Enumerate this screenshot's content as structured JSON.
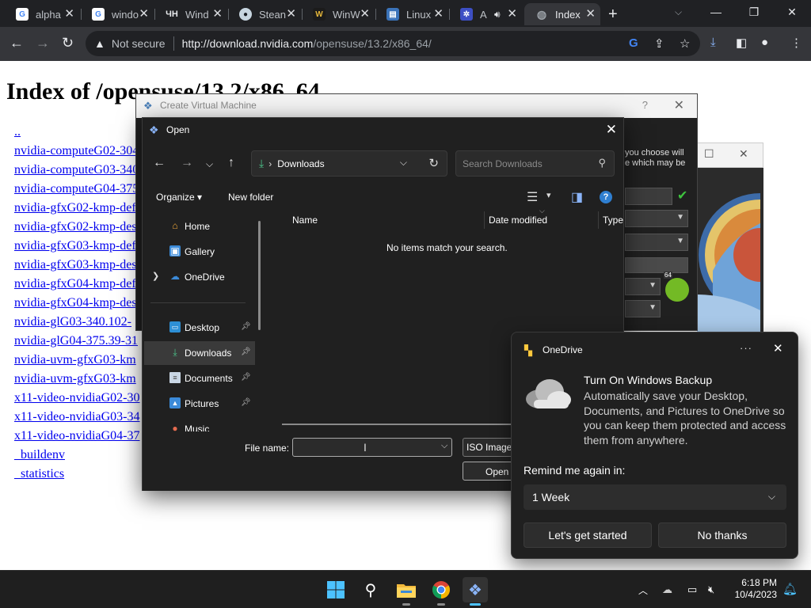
{
  "browser": {
    "tabs": [
      {
        "title": "alpha",
        "favicon": "google-g"
      },
      {
        "title": "windo",
        "favicon": "google-g"
      },
      {
        "title": "Wind",
        "favicon": "4h-logo"
      },
      {
        "title": "Stean",
        "favicon": "steam-logo"
      },
      {
        "title": "WinW",
        "favicon": "winworld-logo"
      },
      {
        "title": "Linux",
        "favicon": "linux-doc-logo"
      },
      {
        "title": "A",
        "favicon": "bluesky-logo"
      },
      {
        "title": "Index",
        "favicon": "globe"
      }
    ],
    "new_tab": "+",
    "security_label": "Not secure",
    "url_host": "http://download.nvidia.com",
    "url_path": "/opensuse/13.2/x86_64/"
  },
  "page": {
    "heading": "Index of /opensuse/13.2/x86_64",
    "entries": [
      "..",
      "nvidia-computeG02-304",
      "nvidia-computeG03-340",
      "nvidia-computeG04-375",
      "nvidia-gfxG02-kmp-def",
      "nvidia-gfxG02-kmp-des",
      "nvidia-gfxG03-kmp-def",
      "nvidia-gfxG03-kmp-des",
      "nvidia-gfxG04-kmp-def",
      "nvidia-gfxG04-kmp-des",
      "nvidia-glG03-340.102-",
      "nvidia-glG04-375.39-31",
      "nvidia-uvm-gfxG03-km",
      "nvidia-uvm-gfxG03-km",
      "x11-video-nvidiaG02-30",
      "x11-video-nvidiaG03-34",
      "x11-video-nvidiaG04-37",
      "_buildenv",
      "_statistics"
    ]
  },
  "vm_dialog": {
    "title": "Create Virtual Machine",
    "help": "?",
    "hint": "you choose will\ne which may be"
  },
  "open_dialog": {
    "title": "Open",
    "location": "Downloads",
    "search_placeholder": "Search Downloads",
    "organize": "Organize",
    "new_folder": "New folder",
    "help": "?",
    "nav_items": [
      {
        "label": "Home",
        "icon": "home-icon"
      },
      {
        "label": "Gallery",
        "icon": "gallery-icon"
      },
      {
        "label": "OneDrive",
        "icon": "onedrive-icon"
      },
      {
        "label": "Desktop",
        "icon": "desktop-icon"
      },
      {
        "label": "Downloads",
        "icon": "downloads-icon"
      },
      {
        "label": "Documents",
        "icon": "documents-icon"
      },
      {
        "label": "Pictures",
        "icon": "pictures-icon"
      },
      {
        "label": "Music",
        "icon": "music-icon"
      }
    ],
    "columns": {
      "name": "Name",
      "date": "Date modified",
      "type": "Type"
    },
    "empty_message": "No items match your search.",
    "file_name_label": "File name:",
    "file_name_value": "",
    "filter": "ISO Images",
    "open_button": "Open"
  },
  "toast": {
    "app": "OneDrive",
    "title": "Turn On Windows Backup",
    "body": "Automatically save your Desktop, Documents, and Pictures to OneDrive so you can keep them protected and access them from anywhere.",
    "remind_label": "Remind me again in:",
    "remind_value": "1 Week",
    "primary": "Let's get started",
    "secondary": "No thanks"
  },
  "taskbar": {
    "time": "6:18 PM",
    "date": "10/4/2023"
  },
  "colors": {
    "link": "#0000ee",
    "accent": "#4cc2ff",
    "dialog_bg": "#202020"
  }
}
